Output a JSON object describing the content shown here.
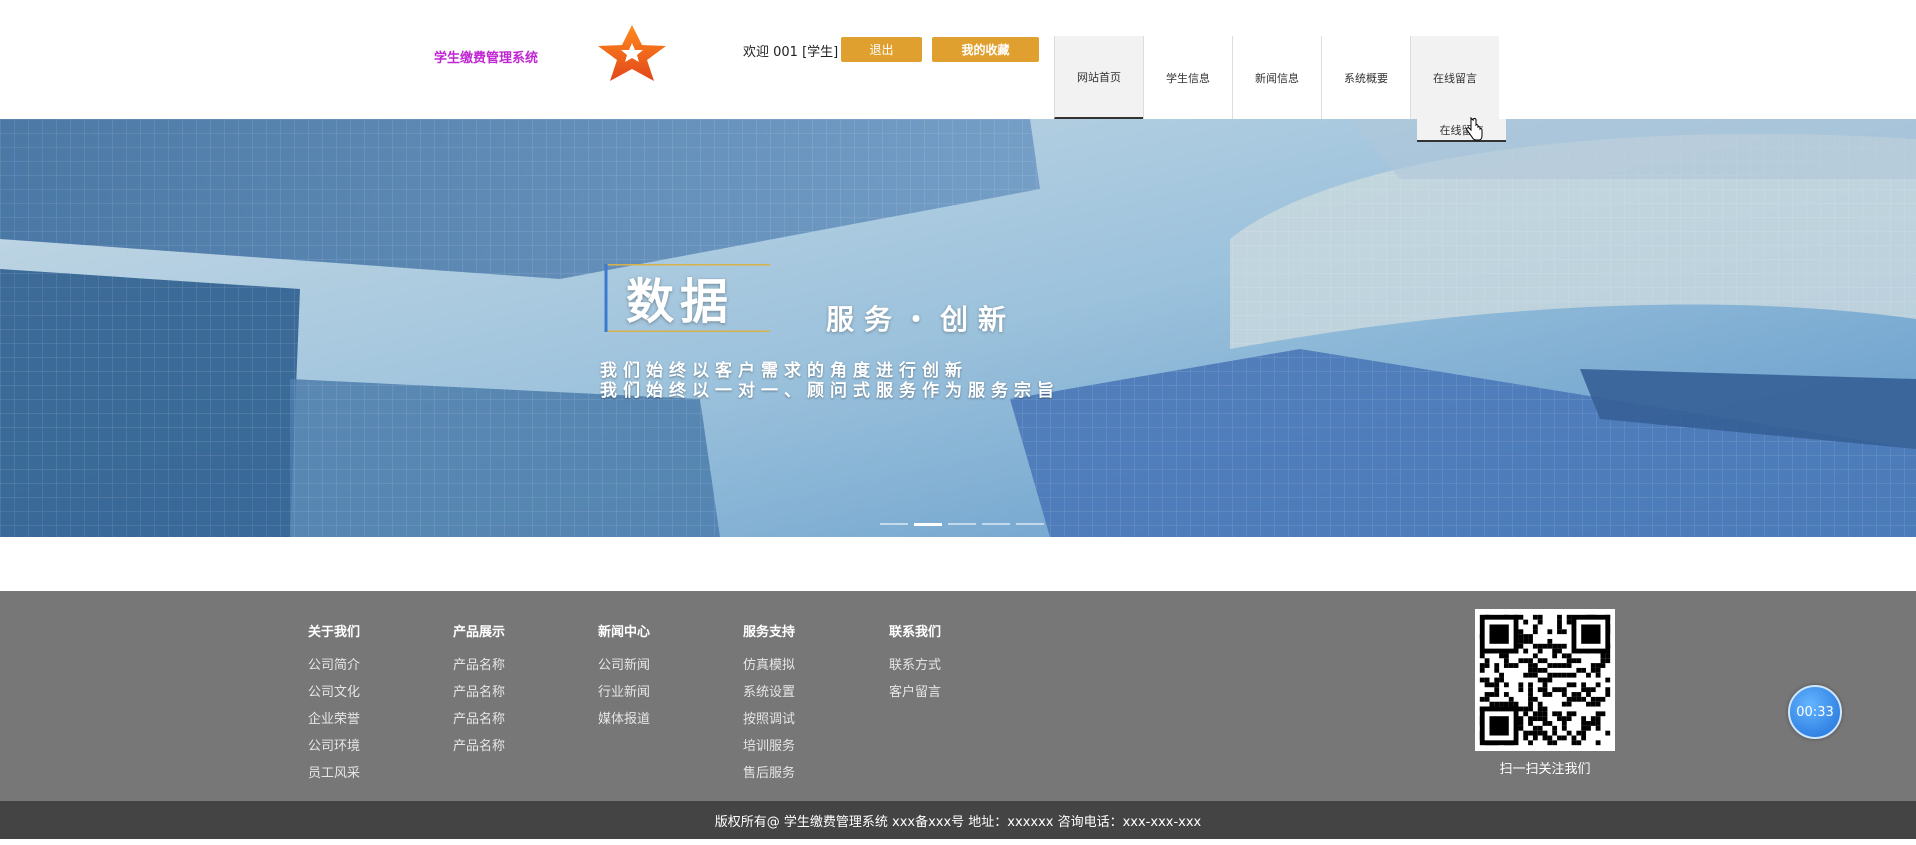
{
  "header": {
    "site_title": "学生缴费管理系统",
    "welcome": "欢迎 001 [学生]",
    "logout_label": "退出",
    "favorites_label": "我的收藏"
  },
  "nav": {
    "items": [
      "网站首页",
      "学生信息",
      "新闻信息",
      "系统概要",
      "在线留言"
    ],
    "dropdown_item": "在线留言"
  },
  "banner": {
    "big_text": "数据",
    "subtitle": "服务・创新",
    "line1": "我们始终以客户需求的角度进行创新",
    "line2": "我们始终以一对一、顾问式服务作为服务宗旨",
    "dots": 5,
    "active_dot": 2
  },
  "footer": {
    "columns": [
      {
        "title": "关于我们",
        "links": [
          "公司简介",
          "公司文化",
          "企业荣誉",
          "公司环境",
          "员工风采"
        ]
      },
      {
        "title": "产品展示",
        "links": [
          "产品名称",
          "产品名称",
          "产品名称",
          "产品名称"
        ]
      },
      {
        "title": "新闻中心",
        "links": [
          "公司新闻",
          "行业新闻",
          "媒体报道"
        ]
      },
      {
        "title": "服务支持",
        "links": [
          "仿真模拟",
          "系统设置",
          "按照调试",
          "培训服务",
          "售后服务"
        ]
      },
      {
        "title": "联系我们",
        "links": [
          "联系方式",
          "客户留言"
        ]
      }
    ],
    "qr_caption": "扫一扫关注我们",
    "timer": "00:33",
    "copyright": "版权所有@ 学生缴费管理系统 xxx备xxx号 地址：xxxxxx 咨询电话：xxx-xxx-xxx"
  },
  "colors": {
    "title": "#c026d3",
    "button": "#e0a030",
    "footer_bg": "#777777",
    "copyright_bg": "#444444"
  },
  "icons": [
    "star-logo-icon",
    "pointer-cursor-icon",
    "qr-code-icon",
    "timer-icon"
  ]
}
